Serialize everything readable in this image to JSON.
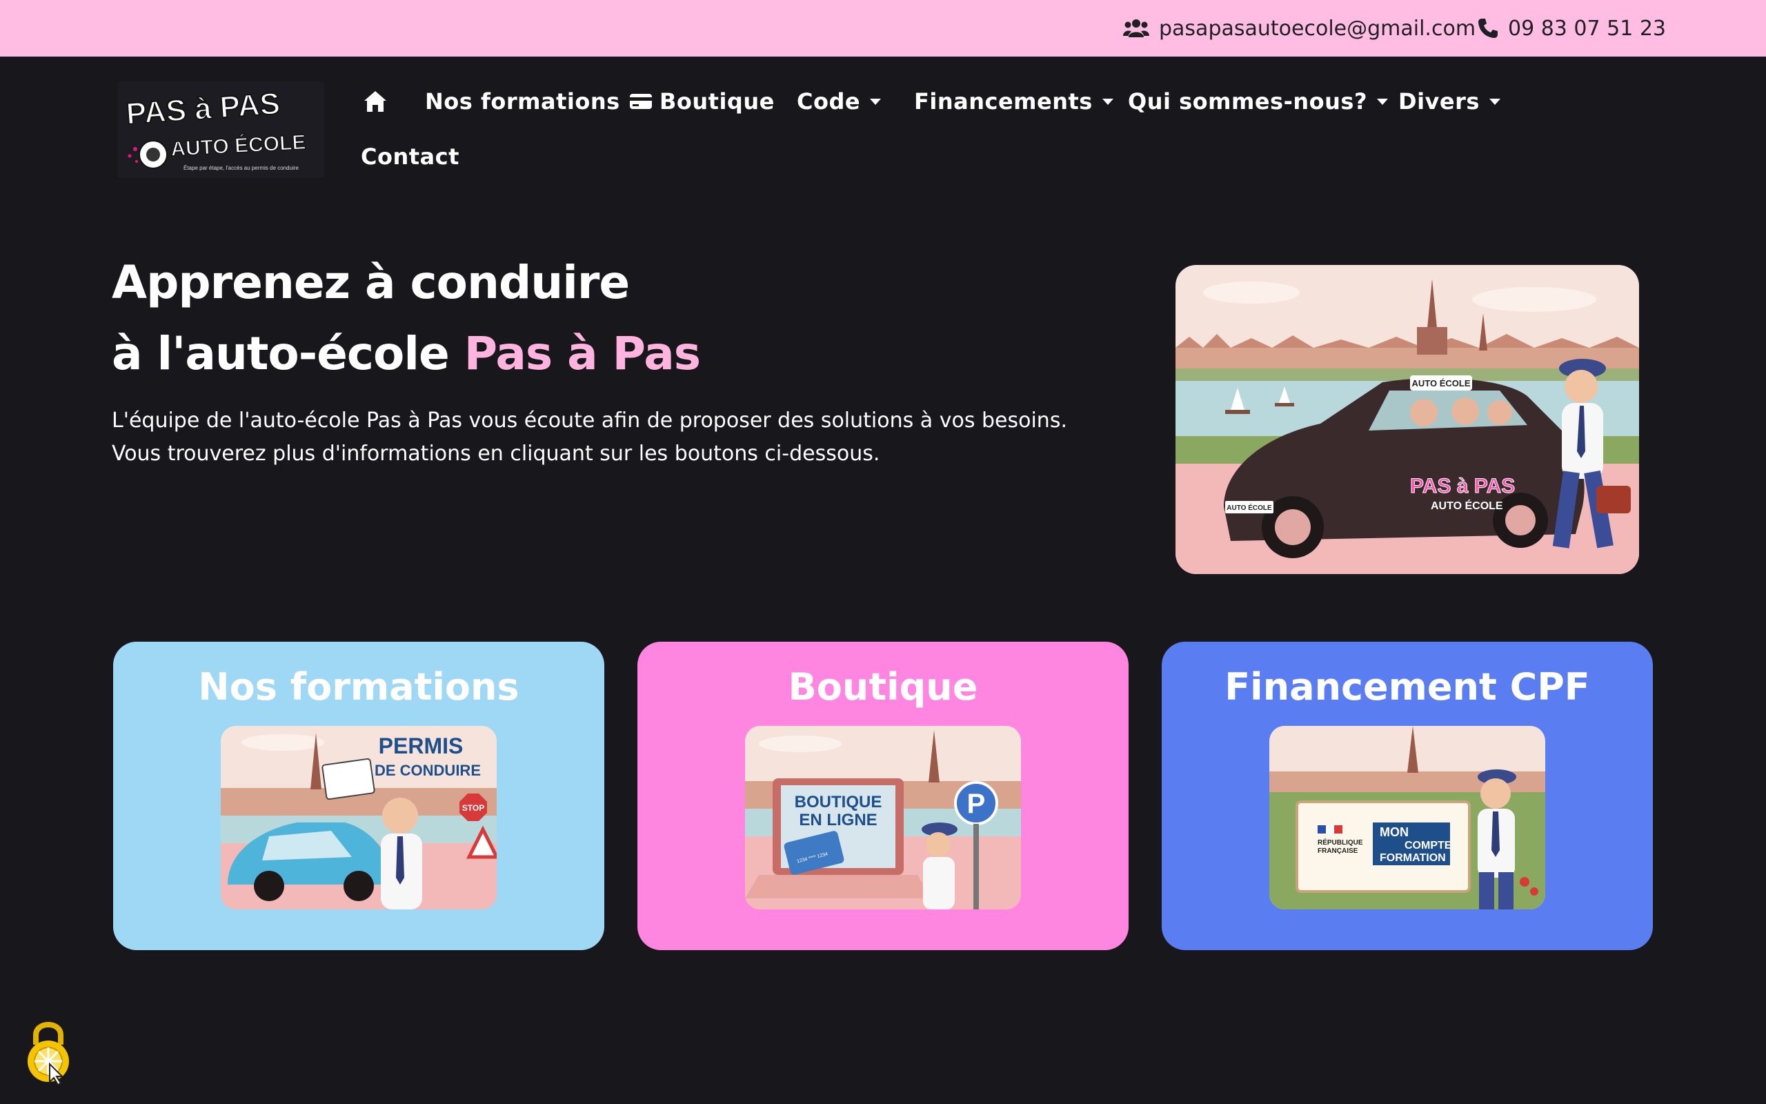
{
  "topbar": {
    "email": "pasapasautoecole@gmail.com",
    "phone": "09 83 07 51 23",
    "email_icon": "users-icon",
    "phone_icon": "phone-icon"
  },
  "logo": {
    "line1": "PAS à PAS",
    "line2": "AUTO ÉCOLE",
    "tagline": "Étape par étape, l'accès au permis de conduire"
  },
  "nav": {
    "home_icon": "home-icon",
    "formations": "Nos formations",
    "boutique": "Boutique",
    "boutique_icon": "credit-card-icon",
    "code": "Code",
    "financements": "Financements",
    "qui": "Qui sommes-nous?",
    "divers": "Divers",
    "contact": "Contact"
  },
  "hero": {
    "title_line1": "Apprenez à conduire",
    "title_line2_prefix": "à l'auto-école ",
    "title_line2_highlight": "Pas à Pas",
    "text_line1": "L'équipe de l'auto-école Pas à Pas vous écoute afin de proposer des solutions à vos besoins.",
    "text_line2": "Vous trouverez plus d'informations en cliquant sur les boutons ci-dessous.",
    "image": {
      "roof_sign": "AUTO ÉCOLE",
      "door_logo_line1": "PAS à PAS",
      "door_logo_line2": "AUTO ÉCOLE",
      "plate": "AUTO ÉCOLE"
    }
  },
  "cards": [
    {
      "title": "Nos formations",
      "image_line1": "PERMIS",
      "image_line2": "DE CONDUIRE",
      "image_sign": "STOP"
    },
    {
      "title": "Boutique",
      "image_line1": "BOUTIQUE",
      "image_line2": "EN LIGNE",
      "image_card": "1234 **** 1234",
      "image_sign": "P"
    },
    {
      "title": "Financement CPF",
      "image_line1": "MON",
      "image_line2": "COMPTE",
      "image_line3": "FORMATION",
      "image_rep1": "RÉPUBLIQUE",
      "image_rep2": "FRANÇAISE"
    }
  ],
  "colors": {
    "topbar": "#ffbde3",
    "background": "#18171c",
    "accent_pink_text": "#ffb3df",
    "card_formations": "#9fd8f5",
    "card_boutique": "#ff86e0",
    "card_cpf": "#5a7df2",
    "logo_pink": "#e8157d"
  },
  "lock_icon": "lock-icon"
}
